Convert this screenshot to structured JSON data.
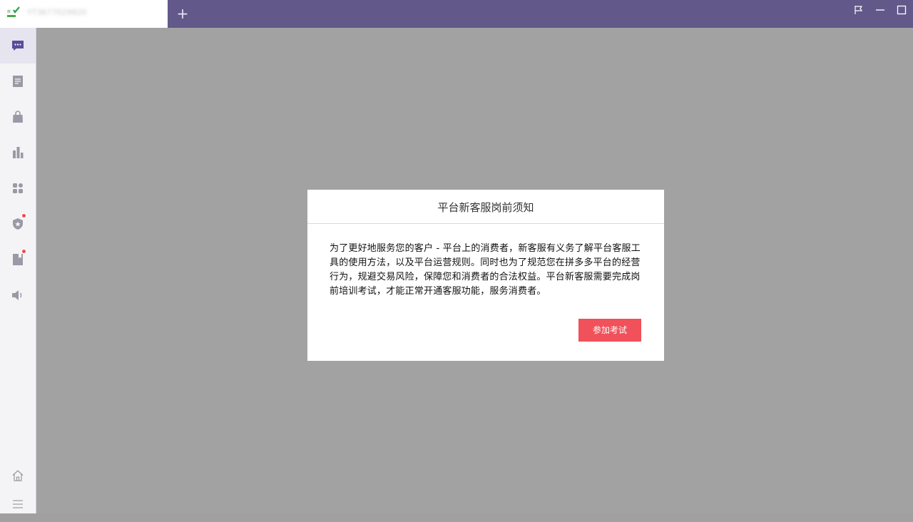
{
  "tab": {
    "title": "YT3677029920"
  },
  "sidebar": {
    "items": [
      {
        "icon": "chat-icon",
        "active": true
      },
      {
        "icon": "document-icon"
      },
      {
        "icon": "shopping-bag-icon"
      },
      {
        "icon": "bar-chart-icon"
      },
      {
        "icon": "apps-grid-icon"
      },
      {
        "icon": "shield-star-icon",
        "badge": true
      },
      {
        "icon": "notebook-icon",
        "badge": true
      },
      {
        "icon": "speaker-icon"
      }
    ],
    "bottom": [
      {
        "icon": "home-icon"
      },
      {
        "icon": "menu-icon"
      }
    ]
  },
  "colors": {
    "titlebar": "#62598a",
    "accent": "#5b4b9c",
    "button": "#f0515a",
    "overlay": "#a2a2a2"
  },
  "modal": {
    "title": "平台新客服岗前须知",
    "body": "为了更好地服务您的客户 - 平台上的消费者，新客服有义务了解平台客服工具的使用方法，以及平台运营规则。同时也为了规范您在拼多多平台的经营行为，规避交易风险，保障您和消费者的合法权益。平台新客服需要完成岗前培训考试，才能正常开通客服功能，服务消费者。",
    "button_label": "参加考试"
  }
}
